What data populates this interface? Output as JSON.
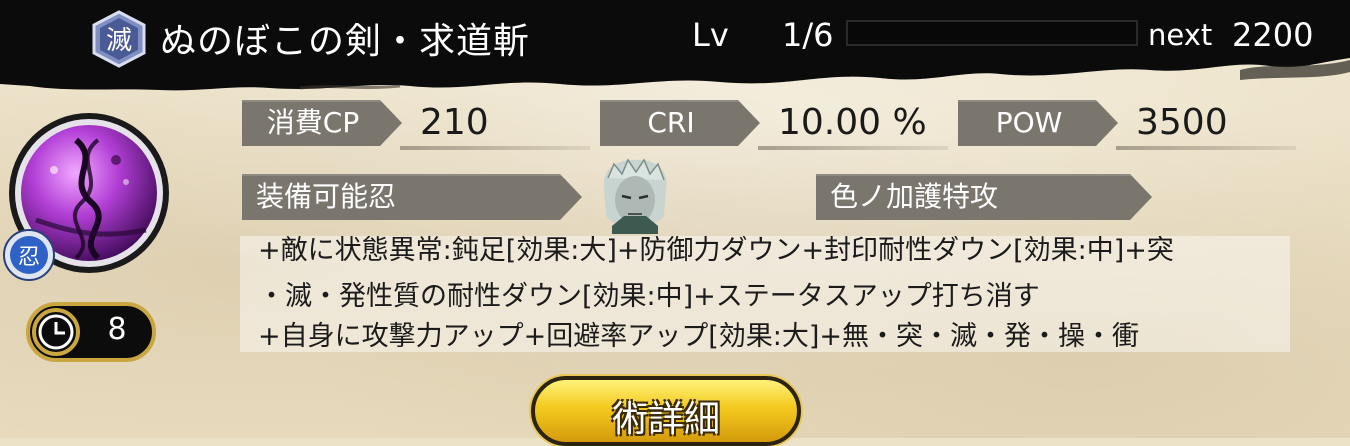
{
  "header": {
    "badge_char": "滅",
    "title": "ぬのぼこの剣・求道斬",
    "lv_label": "Lv",
    "lv_value": "1/6",
    "exp_progress": 0.0,
    "next_label": "next",
    "next_value": "2200"
  },
  "stats": [
    {
      "label": "消費CP",
      "value": "210"
    },
    {
      "label": "CRI",
      "value": "10.00 %"
    },
    {
      "label": "POW",
      "value": "3500"
    }
  ],
  "equip": {
    "label": "装備可能忍",
    "bonus_label": "色ノ加護特攻"
  },
  "skill": {
    "icon": "purple-dna-skill-icon",
    "type_badge": "忍",
    "cooldown": "8"
  },
  "description": [
    "+敵に状態異常:鈍足[効果:大]+防御力ダウン+封印耐性ダウン[効果:中]+突",
    "・滅・発性質の耐性ダウン[効果:中]+ステータスアップ打ち消す",
    "+自身に攻撃力アップ+回避率アップ[効果:大]+無・突・滅・発・操・衝"
  ],
  "buttons": {
    "detail": "術詳細"
  },
  "colors": {
    "header_ink": "#0a0a0a",
    "tag_gray": "#7a766e",
    "button_gold": "#f3c91e",
    "skill_purple": "#b23fd6"
  }
}
